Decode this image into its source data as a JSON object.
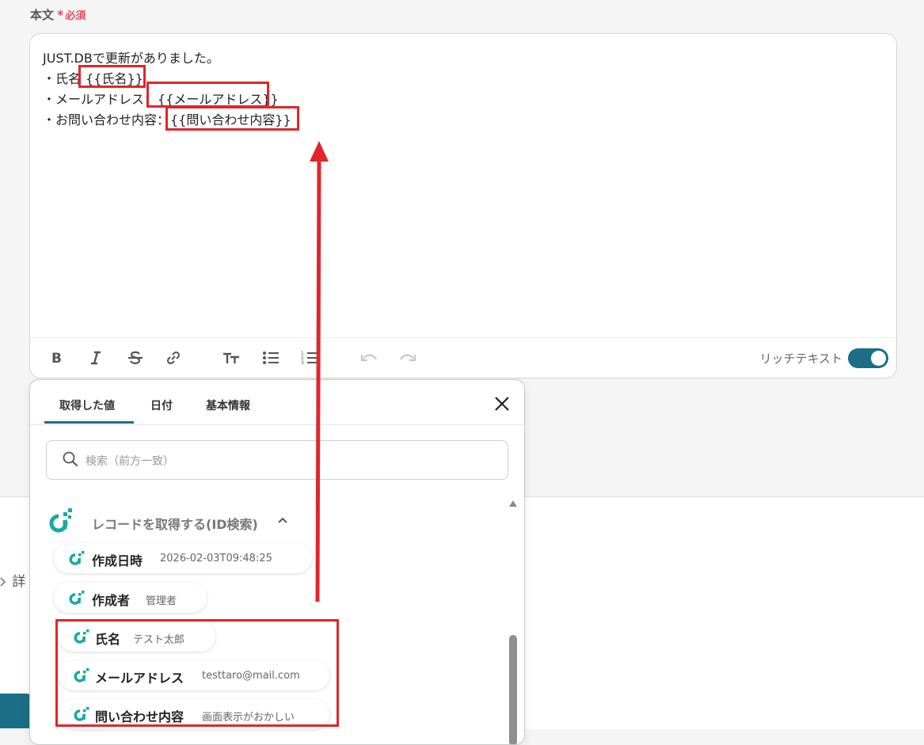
{
  "field": {
    "label": "本文",
    "required_mark": "*",
    "required_text": "必須"
  },
  "editor": {
    "lines": [
      {
        "text": "JUST.DBで更新がありました。"
      },
      {
        "prefix": "・氏名 ",
        "token": "{{氏名}}"
      },
      {
        "prefix": "・メールアドレス：",
        "token": "{{メールアドレス}}"
      },
      {
        "prefix": "・お問い合わせ内容：",
        "token": "{{問い合わせ内容}}"
      }
    ],
    "toolbar": {
      "buttons": [
        "bold-icon",
        "italic-icon",
        "strikethrough-icon",
        "link-icon",
        "text-size-icon",
        "bulleted-list-icon",
        "numbered-list-icon",
        "undo-icon",
        "redo-icon"
      ],
      "rich_text_label": "リッチテキスト",
      "rich_text_enabled": true
    }
  },
  "panel": {
    "tabs": [
      "取得した値",
      "日付",
      "基本情報"
    ],
    "active_tab": "取得した値",
    "search_placeholder": "検索（前方一致）",
    "group_title": "レコードを取得する(ID検索)",
    "items": [
      {
        "name": "作成日時",
        "value": "2026-02-03T09:48:25"
      },
      {
        "name": "作成者",
        "value": "管理者"
      },
      {
        "name": "氏名",
        "value": "テスト太郎"
      },
      {
        "name": "メールアドレス",
        "value": "testtaro@mail.com"
      },
      {
        "name": "問い合わせ内容",
        "value": "画面表示がおかしい"
      }
    ]
  },
  "background": {
    "detail_label": "詳"
  },
  "colors": {
    "accent": "#1a6e87",
    "required": "#e8485a",
    "highlight": "#e0262b"
  }
}
